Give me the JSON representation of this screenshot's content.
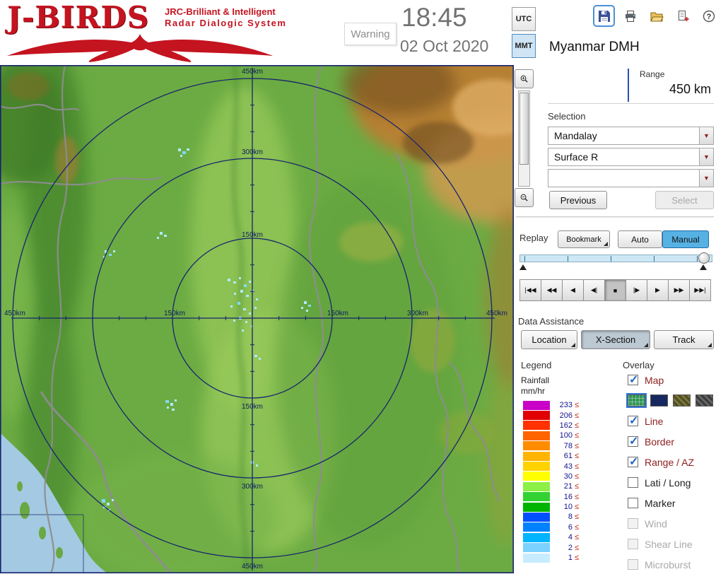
{
  "header": {
    "logo_title": "J-BIRDS",
    "logo_sub1": "JRC-Brilliant & Intelligent",
    "logo_sub2": "Radar Dialogic System",
    "warning": "Warning",
    "time": "18:45",
    "date": "02 Oct 2020",
    "utc": "UTC",
    "mmt": "MMT"
  },
  "panel": {
    "station": "Myanmar DMH",
    "range_label": "Range",
    "range_value": "450 km",
    "selection_label": "Selection",
    "site": "Mandalay",
    "product": "Surface R",
    "extra": "",
    "previous": "Previous",
    "select": "Select"
  },
  "replay": {
    "label": "Replay",
    "bookmark": "Bookmark",
    "auto": "Auto",
    "manual": "Manual",
    "transport": [
      "|◀◀",
      "◀◀",
      "◀",
      "◀|",
      "■",
      "|▶",
      "▶",
      "▶▶",
      "▶▶|"
    ]
  },
  "assistance": {
    "label": "Data Assistance",
    "location": "Location",
    "xsection": "X-Section",
    "track": "Track"
  },
  "legend": {
    "label": "Legend",
    "title": "Rainfall",
    "unit": "mm/hr",
    "op": "≤",
    "entries": [
      {
        "value": "233",
        "color": "#c800c8"
      },
      {
        "value": "206",
        "color": "#e00000"
      },
      {
        "value": "162",
        "color": "#ff3200"
      },
      {
        "value": "100",
        "color": "#ff6400"
      },
      {
        "value": "78",
        "color": "#ff8c00"
      },
      {
        "value": "61",
        "color": "#ffb400"
      },
      {
        "value": "43",
        "color": "#ffd200"
      },
      {
        "value": "30",
        "color": "#ffff00"
      },
      {
        "value": "21",
        "color": "#8cf046"
      },
      {
        "value": "16",
        "color": "#32d232"
      },
      {
        "value": "10",
        "color": "#00b400"
      },
      {
        "value": "8",
        "color": "#0050ff"
      },
      {
        "value": "6",
        "color": "#0082ff"
      },
      {
        "value": "4",
        "color": "#00b4ff"
      },
      {
        "value": "2",
        "color": "#7cd2ff"
      },
      {
        "value": "1",
        "color": "#c8ecff"
      }
    ]
  },
  "overlay": {
    "label": "Overlay",
    "items": [
      {
        "label": "Map",
        "state": "checked"
      },
      {
        "label": "Line",
        "state": "checked"
      },
      {
        "label": "Border",
        "state": "checked"
      },
      {
        "label": "Range / AZ",
        "state": "checked"
      },
      {
        "label": "Lati / Long",
        "state": "unchecked"
      },
      {
        "label": "Marker",
        "state": "unchecked"
      },
      {
        "label": "Wind",
        "state": "disabled"
      },
      {
        "label": "Shear Line",
        "state": "disabled"
      },
      {
        "label": "Microburst",
        "state": "disabled"
      }
    ],
    "map_styles": [
      "#2f9655",
      "#16285f",
      "#55521b",
      "#3f3f3f"
    ]
  },
  "map": {
    "rings": {
      "top": [
        "450km",
        "300km",
        "150km"
      ],
      "bottom": [
        "150km",
        "300km",
        "450km"
      ],
      "left": [
        "450km",
        "150km"
      ],
      "right": [
        "150km",
        "300km",
        "450km"
      ]
    }
  }
}
